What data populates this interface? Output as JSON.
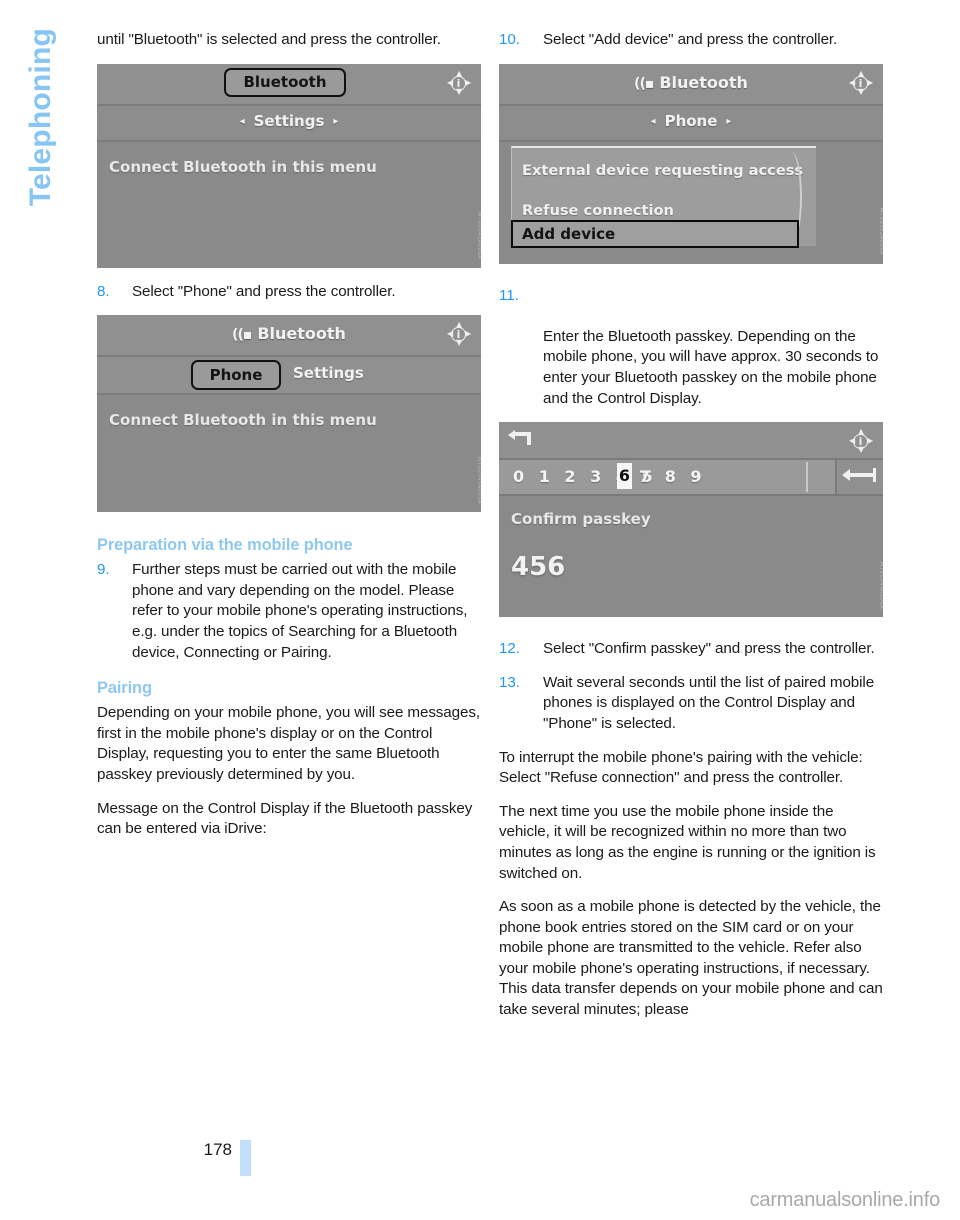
{
  "sidebar": {
    "chapter": "Telephoning"
  },
  "footer": {
    "page_number": "178",
    "brand": "carmanualsonline.info"
  },
  "left_column": {
    "intro_continuation": "until \"Bluetooth\" is selected and press the controller.",
    "step8": {
      "num": "8.",
      "text": "Select \"Phone\" and press the controller."
    },
    "heading_preparation": "Preparation via the mobile phone",
    "step9": {
      "num": "9.",
      "text": "Further steps must be carried out with the mobile phone and vary depending on the model. Please refer to your mobile phone's operating instructions, e.g. under the topics of Searching for a Bluetooth device, Connecting or Pairing."
    },
    "heading_pairing": "Pairing",
    "pairing_para1": "Depending on your mobile phone, you will see messages, first in the mobile phone's display or on the Control Display, requesting you to enter the same Bluetooth passkey previously determined by you.",
    "pairing_para2": "Message on the Control Display if the Bluetooth passkey can be entered via iDrive:"
  },
  "right_column": {
    "step10": {
      "num": "10.",
      "text": "Select \"Add device\" and press the controller."
    },
    "step11": {
      "num": "11.",
      "text": "Enter the Bluetooth passkey. Depending on the mobile phone, you will have approx. 30 seconds to enter your Bluetooth passkey on the mobile phone and the Control Display."
    },
    "step12": {
      "num": "12.",
      "text": "Select \"Confirm passkey\" and press the controller."
    },
    "step13": {
      "num": "13.",
      "text": "Wait several seconds until the list of paired mobile phones is displayed on the Control Display and \"Phone\" is selected."
    },
    "para_interrupt": "To interrupt the mobile phone's pairing with the vehicle:\nSelect \"Refuse connection\" and press the controller.",
    "para_nexttime": "The next time you use the mobile phone inside the vehicle, it will be recognized within no more than two minutes as long as the engine is running or the ignition is switched on.",
    "para_detected": "As soon as a mobile phone is detected by the vehicle, the phone book entries stored on the SIM card or on your mobile phone are transmitted to the vehicle. Refer also your mobile phone's operating instructions, if necessary. This data transfer depends on your mobile phone and can take several minutes; please"
  },
  "screenshots": {
    "shot1": {
      "watermark": "MT00343A00SA",
      "title_chip": "Bluetooth",
      "info_icon": "i",
      "menu_label": "Settings",
      "arrow_left": "◂",
      "arrow_right": "▸",
      "body_line": "Connect Bluetooth in this menu"
    },
    "shot2": {
      "watermark": "MT00345A00SA",
      "bt_icon": "((▪",
      "title": "Bluetooth",
      "info_icon": "i",
      "tab_selected": "Phone",
      "tab_other": "Settings",
      "body_line": "Connect Bluetooth in this menu"
    },
    "shot3": {
      "watermark": "MT00352A00SA",
      "bt_icon": "((▪",
      "title": "Bluetooth",
      "info_icon": "i",
      "menu_label": "Phone",
      "arrow_left": "◂",
      "arrow_right": "▸",
      "popup_items": [
        "External device requesting access",
        "Refuse connection"
      ],
      "selected_item": "Add device"
    },
    "shot4": {
      "watermark": "MT00344A00SA",
      "info_icon": "i",
      "digits_before": "0 1 2 3 4 5",
      "cursor_digit": "6",
      "digits_after": "7 8 9",
      "body_line": "Confirm passkey",
      "passkey_value": "456"
    }
  }
}
